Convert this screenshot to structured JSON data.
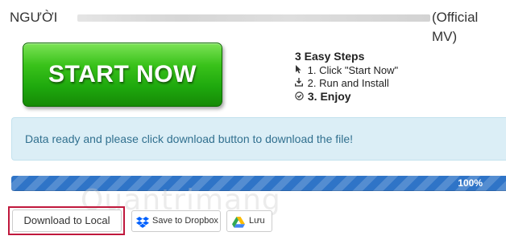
{
  "title": {
    "prefix": "NGƯỜI",
    "suffix": "(Official MV)"
  },
  "start_button": {
    "label": "START NOW"
  },
  "steps": {
    "heading": "3 Easy Steps",
    "items": [
      {
        "icon": "cursor-icon",
        "label": "1. Click \"Start Now\""
      },
      {
        "icon": "download-icon",
        "label": "2. Run and Install"
      },
      {
        "icon": "check-circle-icon",
        "label": "3. Enjoy"
      }
    ]
  },
  "alert": {
    "message": "Data ready and please click download button to download the file!"
  },
  "progress": {
    "value": 100,
    "label": "100%"
  },
  "watermark": {
    "text": "Quantrimang"
  },
  "buttons": {
    "download_local": "Download to Local",
    "save_dropbox": "Save to Dropbox",
    "save_drive": "Lưu"
  },
  "colors": {
    "start_green": "#1ea80d",
    "alert_bg": "#dbeef6",
    "alert_text": "#31708f",
    "progress_blue": "#2f74c7",
    "highlight_red": "#c0183c",
    "dropbox_blue": "#0061fe"
  }
}
